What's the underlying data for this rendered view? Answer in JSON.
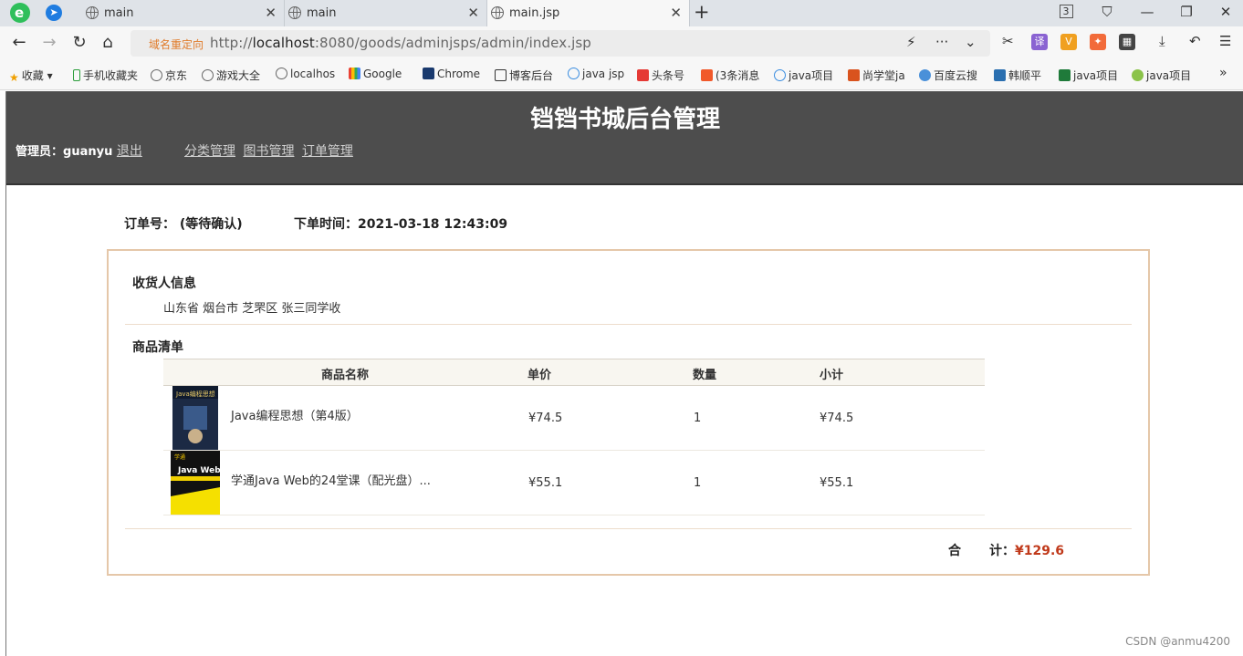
{
  "browser": {
    "tabs": [
      {
        "title": "main"
      },
      {
        "title": "main"
      },
      {
        "title": "main.jsp"
      }
    ],
    "tab_count_badge": "3",
    "redirect_label": "域名重定向",
    "url_prefix": "http://",
    "url_host": "localhost",
    "url_rest": ":8080/goods/adminjsps/admin/index.jsp",
    "bookmarks": [
      "收藏",
      "手机收藏夹",
      "京东",
      "游戏大全",
      "localhos",
      "Google",
      "Chrome",
      "博客后台",
      "java jsp",
      "头条号",
      "(3条消息",
      "java项目",
      "尚学堂ja",
      "百度云搜",
      "韩顺平",
      "java项目",
      "java项目"
    ]
  },
  "header": {
    "site_title": "铛铛书城后台管理",
    "admin_label": "管理员：",
    "admin_name": "guanyu",
    "logout": "退出",
    "menu": [
      "分类管理",
      "图书管理",
      "订单管理"
    ]
  },
  "order": {
    "number_label": "订单号：",
    "status": "(等待确认)",
    "time_label": "下单时间：",
    "time": "2021-03-18 12:43:09"
  },
  "receiver": {
    "title": "收货人信息",
    "address": "山东省 烟台市 芝罘区 张三同学收"
  },
  "items": {
    "title": "商品清单",
    "headers": [
      "商品名称",
      "单价",
      "数量",
      "小计"
    ],
    "rows": [
      {
        "name": "Java编程思想（第4版）",
        "price": "¥74.5",
        "qty": "1",
        "subtotal": "¥74.5",
        "cover_title": "Java编程思想"
      },
      {
        "name": "学通Java Web的24堂课（配光盘）...",
        "price": "¥55.1",
        "qty": "1",
        "subtotal": "¥55.1",
        "cover_title": "Java Web"
      }
    ]
  },
  "total": {
    "label_a": "合",
    "label_b": "计：",
    "value": "¥129.6"
  },
  "watermark": "CSDN @anmu4200",
  "colors": {
    "header_bg": "#4d4d4d",
    "box_border": "#e5c7a9",
    "total": "#c0391a"
  }
}
